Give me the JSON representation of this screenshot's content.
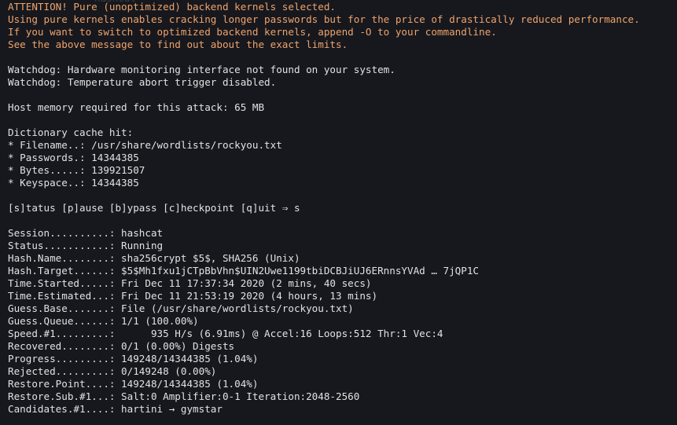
{
  "window": {
    "ghost_text": "hashcat"
  },
  "terminal": {
    "warn_color": "#f0a36a",
    "text_color": "#e2e2e2",
    "background": "#16181e",
    "lines": {
      "l0": "ATTENTION! Pure (unoptimized) backend kernels selected.",
      "l1": "Using pure kernels enables cracking longer passwords but for the price of drastically reduced performance.",
      "l2": "If you want to switch to optimized backend kernels, append -O to your commandline.",
      "l3": "See the above message to find out about the exact limits.",
      "l4": "",
      "l5": "Watchdog: Hardware monitoring interface not found on your system.",
      "l6": "Watchdog: Temperature abort trigger disabled.",
      "l7": "",
      "l8": "Host memory required for this attack: 65 MB",
      "l9": "",
      "l10": "Dictionary cache hit:",
      "l11": "* Filename..: /usr/share/wordlists/rockyou.txt",
      "l12": "* Passwords.: 14344385",
      "l13": "* Bytes.....: 139921507",
      "l14": "* Keyspace..: 14344385",
      "l15": "",
      "l16": "[s]tatus [p]ause [b]ypass [c]heckpoint [q]uit ⇒ s",
      "l17": "",
      "l18": "Session..........: hashcat",
      "l19": "Status...........: Running",
      "l20": "Hash.Name........: sha256crypt $5$, SHA256 (Unix)",
      "l21": "Hash.Target......: $5$Mh1fxu1jCTpBbVhn$UIN2Uwe1199tbiDCBJiUJ6ERnnsYVAd … 7jQP1C",
      "l22": "Time.Started.....: Fri Dec 11 17:37:34 2020 (2 mins, 40 secs)",
      "l23": "Time.Estimated...: Fri Dec 11 21:53:19 2020 (4 hours, 13 mins)",
      "l24": "Guess.Base.......: File (/usr/share/wordlists/rockyou.txt)",
      "l25": "Guess.Queue......: 1/1 (100.00%)",
      "l26": "Speed.#1.........:      935 H/s (6.91ms) @ Accel:16 Loops:512 Thr:1 Vec:4",
      "l27": "Recovered........: 0/1 (0.00%) Digests",
      "l28": "Progress.........: 149248/14344385 (1.04%)",
      "l29": "Rejected.........: 0/149248 (0.00%)",
      "l30": "Restore.Point....: 149248/14344385 (1.04%)",
      "l31": "Restore.Sub.#1...: Salt:0 Amplifier:0-1 Iteration:2048-2560",
      "l32": "Candidates.#1....: hartini → gymstar"
    }
  }
}
